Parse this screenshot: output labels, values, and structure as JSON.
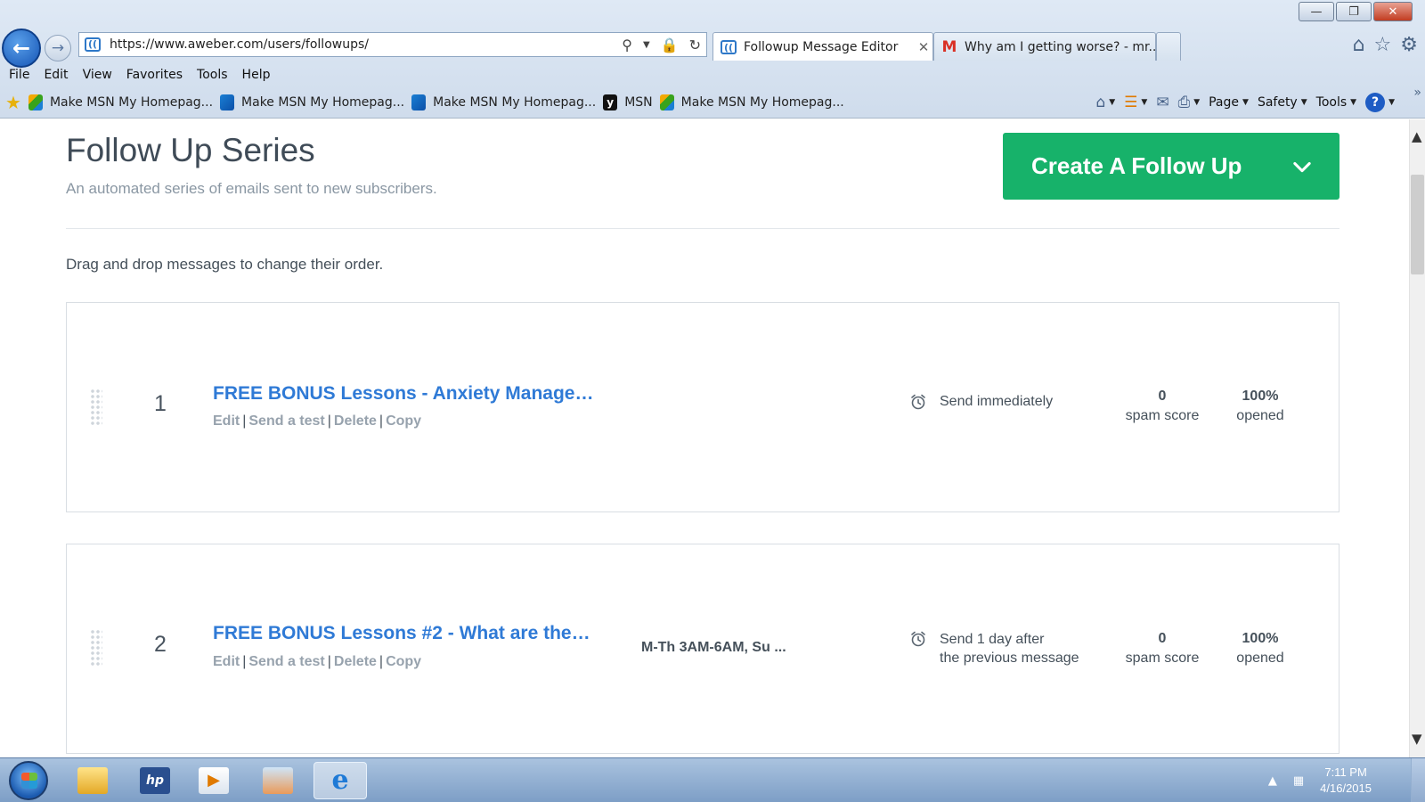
{
  "browser": {
    "window_buttons": {
      "minimize": "—",
      "restore": "❐",
      "close": "✕"
    },
    "address_url": "https://www.aweber.com/users/followups/",
    "tabs": [
      {
        "title": "Followup Message Editor",
        "favicon": "aweber-favicon"
      },
      {
        "title": "Why am I getting worse? - mr...",
        "favicon": "gmail-favicon"
      }
    ],
    "menu": [
      "File",
      "Edit",
      "View",
      "Favorites",
      "Tools",
      "Help"
    ],
    "favorites": [
      {
        "label": "Make MSN My Homepag...",
        "icon": "msn-butterfly-icon"
      },
      {
        "label": "Make MSN My Homepag...",
        "icon": "msn-butterfly-icon"
      },
      {
        "label": "Make MSN My Homepag...",
        "icon": "msn-butterfly-icon"
      },
      {
        "label": "MSN",
        "icon": "msn-icon"
      },
      {
        "label": "Make MSN My Homepag...",
        "icon": "msn-butterfly-icon"
      }
    ],
    "command_bar": {
      "page": "Page",
      "safety": "Safety",
      "tools": "Tools",
      "help": "?"
    }
  },
  "page": {
    "title": "Follow Up Series",
    "subtitle": "An automated series of emails sent to new subscribers.",
    "create_button": "Create A Follow Up",
    "drag_hint": "Drag and drop messages to change their order.",
    "messages": [
      {
        "number": "1",
        "title": "FREE BONUS Lessons - Anxiety Manage…",
        "actions": [
          "Edit",
          "Send a test",
          "Delete",
          "Copy"
        ],
        "schedule": "",
        "send_line1": "Send immediately",
        "send_line2": "",
        "spam_value": "0",
        "spam_label": "spam score",
        "open_value": "100%",
        "open_label": "opened"
      },
      {
        "number": "2",
        "title": "FREE BONUS Lessons #2 - What are the…",
        "actions": [
          "Edit",
          "Send a test",
          "Delete",
          "Copy"
        ],
        "schedule": "M-Th 3AM-6AM, Su ...",
        "send_line1": "Send 1 day after",
        "send_line2": "the previous message",
        "spam_value": "0",
        "spam_label": "spam score",
        "open_value": "100%",
        "open_label": "opened"
      }
    ],
    "colors": {
      "accent_green": "#17b26a",
      "link_blue": "#2f7ad6"
    }
  },
  "taskbar": {
    "time": "7:11 PM",
    "date": "4/16/2015"
  }
}
